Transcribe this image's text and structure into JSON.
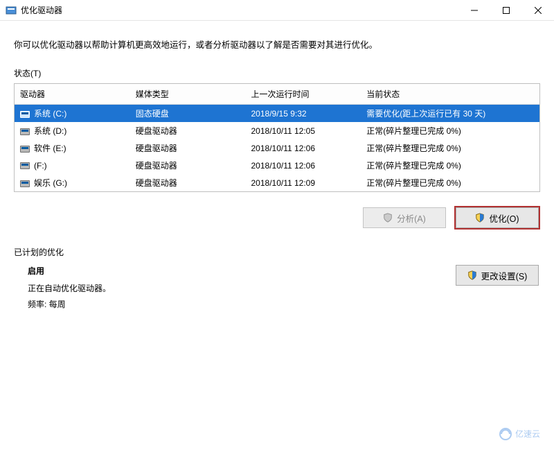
{
  "window": {
    "title": "优化驱动器"
  },
  "intro": "你可以优化驱动器以帮助计算机更高效地运行，或者分析驱动器以了解是否需要对其进行优化。",
  "status_label": "状态(T)",
  "columns": {
    "drive": "驱动器",
    "media": "媒体类型",
    "last_run": "上一次运行时间",
    "state": "当前状态"
  },
  "drives": [
    {
      "name": "系统 (C:)",
      "media": "固态硬盘",
      "last_run": "2018/9/15 9:32",
      "state": "需要优化(距上次运行已有 30 天)",
      "selected": true
    },
    {
      "name": "系统 (D:)",
      "media": "硬盘驱动器",
      "last_run": "2018/10/11 12:05",
      "state": "正常(碎片整理已完成 0%)",
      "selected": false
    },
    {
      "name": "软件 (E:)",
      "media": "硬盘驱动器",
      "last_run": "2018/10/11 12:06",
      "state": "正常(碎片整理已完成 0%)",
      "selected": false
    },
    {
      "name": "(F:)",
      "media": "硬盘驱动器",
      "last_run": "2018/10/11 12:06",
      "state": "正常(碎片整理已完成 0%)",
      "selected": false
    },
    {
      "name": "娱乐 (G:)",
      "media": "硬盘驱动器",
      "last_run": "2018/10/11 12:09",
      "state": "正常(碎片整理已完成 0%)",
      "selected": false
    }
  ],
  "buttons": {
    "analyze": "分析(A)",
    "optimize": "优化(O)",
    "change_settings": "更改设置(S)"
  },
  "schedule": {
    "section_label": "已计划的优化",
    "enabled_label": "启用",
    "status_line": "正在自动优化驱动器。",
    "freq_line": "频率: 每周"
  },
  "watermark": "亿速云"
}
